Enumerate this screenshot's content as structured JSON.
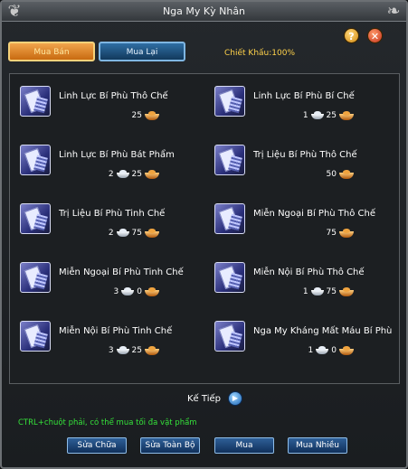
{
  "window": {
    "title": "Nga My Kỳ Nhân"
  },
  "tabs": {
    "buy_label": "Mua Bán",
    "buyback_label": "Mua Lại"
  },
  "discount_text": "Chiết Khấu:100%",
  "items": [
    {
      "name": "Linh Lực Bí Phù Thô Chế",
      "silver": "",
      "gold": "25"
    },
    {
      "name": "Linh Lực Bí Phù Bí Chế",
      "silver": "1",
      "gold": "25"
    },
    {
      "name": "Linh Lực Bí Phù Bát Phẩm",
      "silver": "2",
      "gold": "25"
    },
    {
      "name": "Trị Liệu Bí Phù Thô Chế",
      "silver": "",
      "gold": "50"
    },
    {
      "name": "Trị Liệu Bí Phù Tinh Chế",
      "silver": "2",
      "gold": "75"
    },
    {
      "name": "Miễn Ngoại Bí Phù Thô Chế",
      "silver": "",
      "gold": "75"
    },
    {
      "name": "Miễn Ngoại Bí Phù Tinh Chế",
      "silver": "3",
      "gold": "0"
    },
    {
      "name": "Miễn Nội Bí Phù Thô Chế",
      "silver": "1",
      "gold": "75"
    },
    {
      "name": "Miễn Nội Bí Phù Tinh Chế",
      "silver": "3",
      "gold": "25"
    },
    {
      "name": "Nga My Kháng Mất Máu Bí Phù",
      "silver": "1",
      "gold": "0"
    }
  ],
  "pagination": {
    "next_label": "Kế Tiếp"
  },
  "hint_text": "CTRL+chuột phải, có thể mua tối đa vật phẩm",
  "buttons": {
    "repair_label": "Sửa Chữa",
    "repair_all_label": "Sửa Toàn Bộ",
    "buy_label": "Mua",
    "buy_many_label": "Mua Nhiều"
  },
  "icons": {
    "corner": "ornament-icon",
    "help": "question-icon",
    "close": "close-icon",
    "next": "play-arrow-icon",
    "silver_currency": "silver-ingot-icon",
    "gold_currency": "gold-ingot-icon"
  },
  "colors": {
    "hint": "#35e23a",
    "discount": "#ffd24a",
    "active_tab": "#d9801e",
    "button": "#1f4a7e"
  }
}
